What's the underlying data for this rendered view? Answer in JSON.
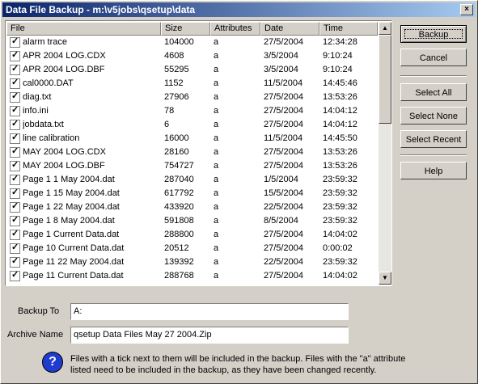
{
  "window": {
    "title": "Data File Backup - m:\\v5jobs\\qsetup\\data",
    "close_label": "×"
  },
  "table": {
    "columns": [
      "File",
      "Size",
      "Attributes",
      "Date",
      "Time"
    ],
    "rows": [
      {
        "file": "alarm trace",
        "size": "104000",
        "attr": "a",
        "date": "27/5/2004",
        "time": "12:34:28",
        "checked": true
      },
      {
        "file": "APR 2004 LOG.CDX",
        "size": "4608",
        "attr": "a",
        "date": "3/5/2004",
        "time": "9:10:24",
        "checked": true
      },
      {
        "file": "APR 2004 LOG.DBF",
        "size": "55295",
        "attr": "a",
        "date": "3/5/2004",
        "time": "9:10:24",
        "checked": true
      },
      {
        "file": "cal0000.DAT",
        "size": "1152",
        "attr": "a",
        "date": "11/5/2004",
        "time": "14:45:46",
        "checked": true
      },
      {
        "file": "diag.txt",
        "size": "27906",
        "attr": "a",
        "date": "27/5/2004",
        "time": "13:53:26",
        "checked": true
      },
      {
        "file": "info.ini",
        "size": "78",
        "attr": "a",
        "date": "27/5/2004",
        "time": "14:04:12",
        "checked": true
      },
      {
        "file": "jobdata.txt",
        "size": "6",
        "attr": "a",
        "date": "27/5/2004",
        "time": "14:04:12",
        "checked": true
      },
      {
        "file": "line calibration",
        "size": "16000",
        "attr": "a",
        "date": "11/5/2004",
        "time": "14:45:50",
        "checked": true
      },
      {
        "file": "MAY 2004 LOG.CDX",
        "size": "28160",
        "attr": "a",
        "date": "27/5/2004",
        "time": "13:53:26",
        "checked": true
      },
      {
        "file": "MAY 2004 LOG.DBF",
        "size": "754727",
        "attr": "a",
        "date": "27/5/2004",
        "time": "13:53:26",
        "checked": true
      },
      {
        "file": "Page 1 1 May 2004.dat",
        "size": "287040",
        "attr": "a",
        "date": "1/5/2004",
        "time": "23:59:32",
        "checked": true
      },
      {
        "file": "Page 1 15 May 2004.dat",
        "size": "617792",
        "attr": "a",
        "date": "15/5/2004",
        "time": "23:59:32",
        "checked": true
      },
      {
        "file": "Page 1 22 May 2004.dat",
        "size": "433920",
        "attr": "a",
        "date": "22/5/2004",
        "time": "23:59:32",
        "checked": true
      },
      {
        "file": "Page 1 8 May 2004.dat",
        "size": "591808",
        "attr": "a",
        "date": "8/5/2004",
        "time": "23:59:32",
        "checked": true
      },
      {
        "file": "Page 1 Current Data.dat",
        "size": "288800",
        "attr": "a",
        "date": "27/5/2004",
        "time": "14:04:02",
        "checked": true
      },
      {
        "file": "Page 10 Current Data.dat",
        "size": "20512",
        "attr": "a",
        "date": "27/5/2004",
        "time": "0:00:02",
        "checked": true
      },
      {
        "file": "Page 11 22 May 2004.dat",
        "size": "139392",
        "attr": "a",
        "date": "22/5/2004",
        "time": "23:59:32",
        "checked": true
      },
      {
        "file": "Page 11 Current Data.dat",
        "size": "288768",
        "attr": "a",
        "date": "27/5/2004",
        "time": "14:04:02",
        "checked": true
      }
    ]
  },
  "buttons": {
    "backup": "Backup",
    "cancel": "Cancel",
    "select_all": "Select All",
    "select_none": "Select None",
    "select_recent": "Select Recent",
    "help": "Help"
  },
  "form": {
    "backup_to_label": "Backup To",
    "backup_to_value": "A:",
    "archive_name_label": "Archive Name",
    "archive_name_value": "qsetup Data Files May 27 2004.Zip"
  },
  "note": "Files with a tick next to them will be included in the backup. Files with the \"a\" attribute listed need to be included in the backup, as they have been changed recently.",
  "icons": {
    "info": "question-icon",
    "check": "checkmark-icon"
  }
}
